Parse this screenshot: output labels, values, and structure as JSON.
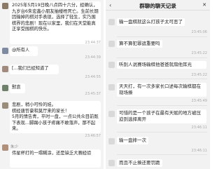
{
  "left": {
    "msg1": {
      "text": "2025年5月19日晚八点四十六分，经确认，九岁台6朱宏鑫小朋友抽楼梧死亡。生前长期因输掉的棋对手表现，选择了轻生，实乃围棋界的悲剧！现在以家里，我们在天堂能真正享受围棋的快乐。",
      "time": "23:44:37"
    },
    "msg2": {
      "text": "@所有人",
      "time": "23:44:39"
    },
    "msg3": {
      "text": "[...我们已经知道了",
      "time": "23:44:55"
    },
    "msg4": {
      "text": "默哀",
      "time": "23:45:37"
    },
    "msg5": {
      "text": "悲剧，稍小可怜的娃。\n棋经唐哲豪和莫厅来的家长！\n5月的情告青，平时一盘，一点公共众目前既下表现...脚踢小孩子疼痛不敢落声，那不起来。",
      "time": "23:46:57"
    },
    "msg6": {
      "name": "朱少",
      "text": "伟星杯打的一塌糊涂，还是缺乏大赛经验"
    }
  },
  "right": {
    "header": {
      "title": "群聊的聊天记录",
      "back": "‹",
      "close": "✕"
    },
    "rows": [
      {
        "text": "输一盘棋就这么打孩子太可恶了",
        "time": "23:45:06"
      },
      {
        "text": "算不算犯罪遮重要吗",
        "time": "23:45:22"
      },
      {
        "text": "听别人说赛场输棋他爸爸就扇他耳光",
        "time": "23:45:22"
      },
      {
        "text": "天天打，有一次多家长口述每次输棋都在现场揍",
        "time": "23:45:49"
      },
      {
        "text": "可惜的是一个孩子在最有天赋的地方被压迫到选择离开",
        "time": "23:46:11"
      },
      {
        "text": "输一盘摔一次",
        "time": "23:46:11"
      },
      {
        "text": "而且不止揍还要罚跪",
        "time": ""
      }
    ]
  }
}
